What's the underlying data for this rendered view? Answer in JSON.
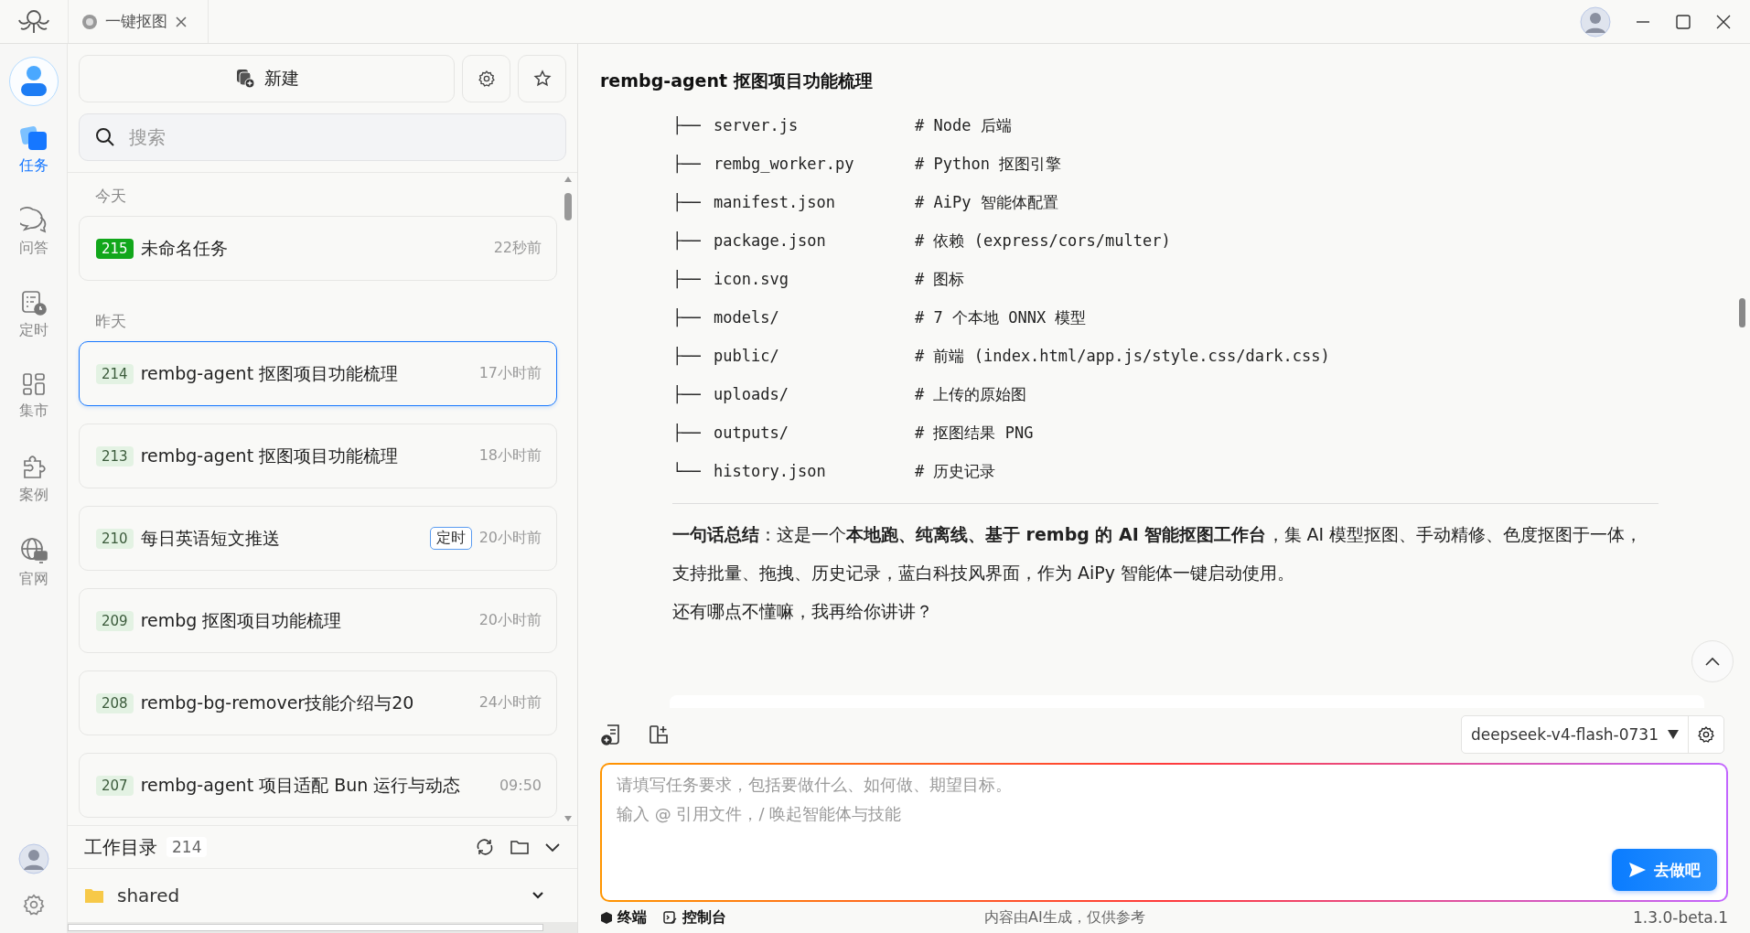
{
  "window": {
    "tab": "一键抠图"
  },
  "rail": {
    "items": [
      {
        "label": "任务",
        "selected": true
      },
      {
        "label": "问答",
        "selected": false
      },
      {
        "label": "定时",
        "selected": false
      },
      {
        "label": "集市",
        "selected": false
      },
      {
        "label": "案例",
        "selected": false
      },
      {
        "label": "官网",
        "selected": false
      }
    ]
  },
  "sidebar": {
    "new_button": "新建",
    "search": {
      "placeholder": "搜索"
    },
    "groups": [
      {
        "heading": "今天",
        "tasks": [
          {
            "number": "215",
            "color": "#12a71b",
            "title": "未命名任务",
            "time": "22秒前",
            "selected": false
          }
        ]
      },
      {
        "heading": "昨天",
        "tasks": [
          {
            "number": "214",
            "color": "#e3f2e3",
            "title": "rembg-agent 抠图项目功能梳理",
            "time": "17小时前",
            "selected": true
          },
          {
            "number": "213",
            "color": "#e3f2e3",
            "title": "rembg-agent 抠图项目功能梳理",
            "time": "18小时前",
            "selected": false
          },
          {
            "number": "210",
            "color": "#e3f2e3",
            "title": "每日英语短文推送",
            "tag": "定时",
            "time": "20小时前",
            "selected": false
          },
          {
            "number": "209",
            "color": "#e3f2e3",
            "title": "rembg 抠图项目功能梳理",
            "time": "20小时前",
            "selected": false
          },
          {
            "number": "208",
            "color": "#e3f2e3",
            "title": "rembg-bg-remover技能介绍与20",
            "time": "24小时前",
            "selected": false
          },
          {
            "number": "207",
            "color": "#e3f2e3",
            "title": "rembg-agent 项目适配 Bun 运行与动态",
            "time": "09:50",
            "selected": false
          }
        ]
      }
    ],
    "workspace": {
      "title": "工作目录",
      "count": "214",
      "folders": [
        "shared"
      ]
    }
  },
  "main": {
    "title": "rembg-agent 抠图项目功能梳理",
    "tree": [
      {
        "branch": "├──",
        "name": "server.js",
        "comment": "# Node 后端"
      },
      {
        "branch": "├──",
        "name": "rembg_worker.py",
        "comment": "# Python 抠图引擎"
      },
      {
        "branch": "├──",
        "name": "manifest.json",
        "comment": "# AiPy 智能体配置"
      },
      {
        "branch": "├──",
        "name": "package.json",
        "comment": "# 依赖 (express/cors/multer)"
      },
      {
        "branch": "├──",
        "name": "icon.svg",
        "comment": "# 图标"
      },
      {
        "branch": "├──",
        "name": "models/",
        "comment": "# 7 个本地 ONNX 模型"
      },
      {
        "branch": "├──",
        "name": "public/",
        "comment": "# 前端 (index.html/app.js/style.css/dark.css)"
      },
      {
        "branch": "├──",
        "name": "uploads/",
        "comment": "# 上传的原始图"
      },
      {
        "branch": "├──",
        "name": "outputs/",
        "comment": "# 抠图结果 PNG"
      },
      {
        "branch": "└──",
        "name": "history.json",
        "comment": "# 历史记录"
      }
    ],
    "summary": "**一句话总结**：这是一个**本地跑、纯离线、基于 rembg 的 AI 智能抠图工作台**，集 AI 模型抠图、手动精修、色度抠图于一体，支持批量、拖拽、历史记录，蓝白科技风界面，作为 AiPy 智能体一键启动使用。",
    "followup": "还有哪点不懂嘛，我再给你讲讲？",
    "model": "deepseek-v4-flash-0731",
    "input": {
      "placeholder": [
        "请填写任务要求，包括要做什么、如何做、期望目标。",
        "输入 @ 引用文件，/ 唤起智能体与技能"
      ]
    },
    "send_button": "去做吧",
    "footer": {
      "terminal": "终端",
      "console": "控制台",
      "notice": "内容由AI生成，仅供参考",
      "version": "1.3.0-beta.1"
    }
  }
}
